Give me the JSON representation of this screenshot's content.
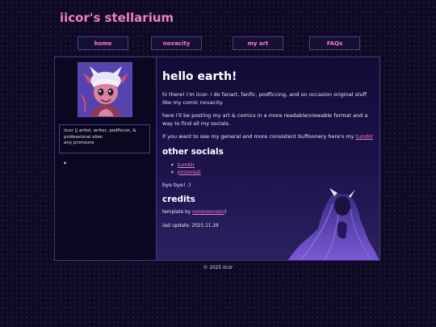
{
  "site": {
    "title": "iicor's stellarium"
  },
  "nav": [
    {
      "label": "home"
    },
    {
      "label": "novacity"
    },
    {
      "label": "my art"
    },
    {
      "label": "FAQs"
    }
  ],
  "sidebar": {
    "bio_line1": "iicor || artist, writer, podficcer, & professional alien",
    "bio_line2": "any pronouns",
    "sparkle": "✦"
  },
  "main": {
    "heading": "hello earth!",
    "intro": "hi there! i'm iicor- i do fanart, fanfic, podficcing, and on occasion original stuff like my comic novacity.",
    "purpose": "here i'll be posting my art & comics in a more readable/viewable format and a way to find all my socials.",
    "general_text": "if you want to see my general and more consistent buffoonery here's my",
    "general_link": "tumblr",
    "socials_heading": "other socials",
    "socials": [
      {
        "label": "tumblr"
      },
      {
        "label": "pinterest"
      }
    ],
    "bye": "bye bye! :)",
    "credits_heading": "credits",
    "template_prefix": "template by",
    "template_link": "nomnomnami",
    "template_suffix": "!",
    "last_update": "last update: 2025.11.28"
  },
  "footer": {
    "text": "© 2025 iicor"
  },
  "colors": {
    "accent": "#f27ec4",
    "border": "#463a80",
    "background": "#0f0a24"
  }
}
